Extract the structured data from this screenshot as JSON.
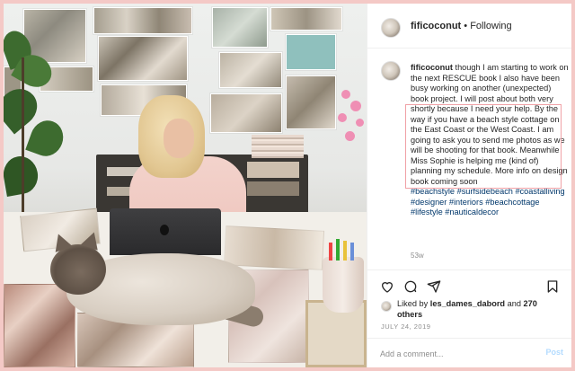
{
  "post": {
    "header": {
      "username": "fificoconut",
      "separator": "•",
      "follow_label": "Following"
    },
    "caption": {
      "username": "fificoconut",
      "text": "though I am starting to work on the next RESCUE book I also have been busy working on another (unexpected) book project. I will post about both very shortly because I need your help. By the way if you have a beach style cottage on the East Coast or the West Coast. I am going to ask you to send me photos as we will be shooting for that book. Meanwhile Miss Sophie is helping me (kind of) planning my schedule. More info on design book coming soon",
      "hashtags": "#beachstyle #surfsidebeach #coastalliving #designer #interiors #beachcottage #lifestyle #nauticaldecor",
      "age": "53w"
    },
    "actions": {
      "like_icon": "heart-icon",
      "comment_icon": "comment-icon",
      "share_icon": "share-icon",
      "save_icon": "bookmark-icon"
    },
    "likes": {
      "prefix": "Liked by",
      "user": "les_dames_dabord",
      "conjunction": "and",
      "others": "270 others"
    },
    "date": "JULY 24, 2019",
    "comment": {
      "placeholder": "Add a comment...",
      "post_label": "Post"
    }
  },
  "colors": {
    "border_pink": "#f4c9c6",
    "highlight": "#f0a1a6",
    "link": "#00376b",
    "muted": "#8e8e8e",
    "post_disabled": "#b3dbff"
  }
}
